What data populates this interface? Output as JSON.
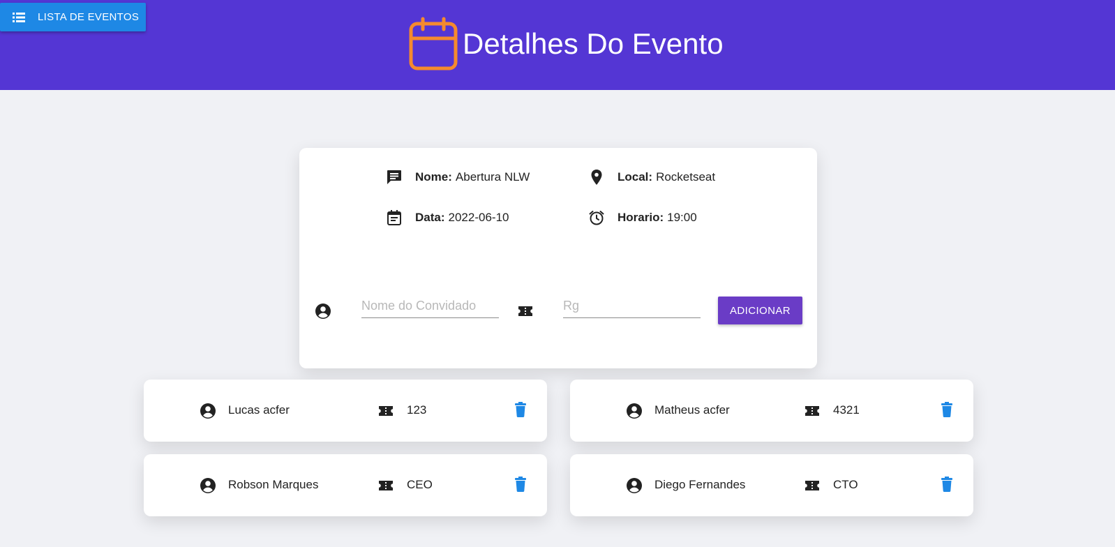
{
  "header": {
    "list_button_label": "LISTA DE EVENTOS",
    "title": "Detalhes Do Evento",
    "background": "#5436d4",
    "calendar_icon_color": "#f58a2e"
  },
  "event": {
    "nome_label": "Nome:",
    "nome": "Abertura NLW",
    "local_label": "Local:",
    "local": "Rocketseat",
    "data_label": "Data:",
    "data": "2022-06-10",
    "horario_label": "Horario:",
    "horario": "19:00"
  },
  "form": {
    "name_placeholder": "Nome do Convidado",
    "rg_placeholder": "Rg",
    "add_button_label": "ADICIONAR",
    "add_button_color": "#6a3cc6"
  },
  "guests": [
    {
      "name": "Lucas acfer",
      "rg": "123"
    },
    {
      "name": "Matheus acfer",
      "rg": "4321"
    },
    {
      "name": "Robson Marques",
      "rg": "CEO"
    },
    {
      "name": "Diego Fernandes",
      "rg": "CTO"
    }
  ],
  "icons": {
    "menu": "list-icon",
    "calendar": "calendar-icon",
    "message": "message-icon",
    "location": "location-pin-icon",
    "date": "event-note-icon",
    "time": "alarm-clock-icon",
    "person": "account-circle-icon",
    "ticket": "ticket-icon",
    "delete": "trash-icon"
  },
  "delete_icon_color": "#1e88e5"
}
